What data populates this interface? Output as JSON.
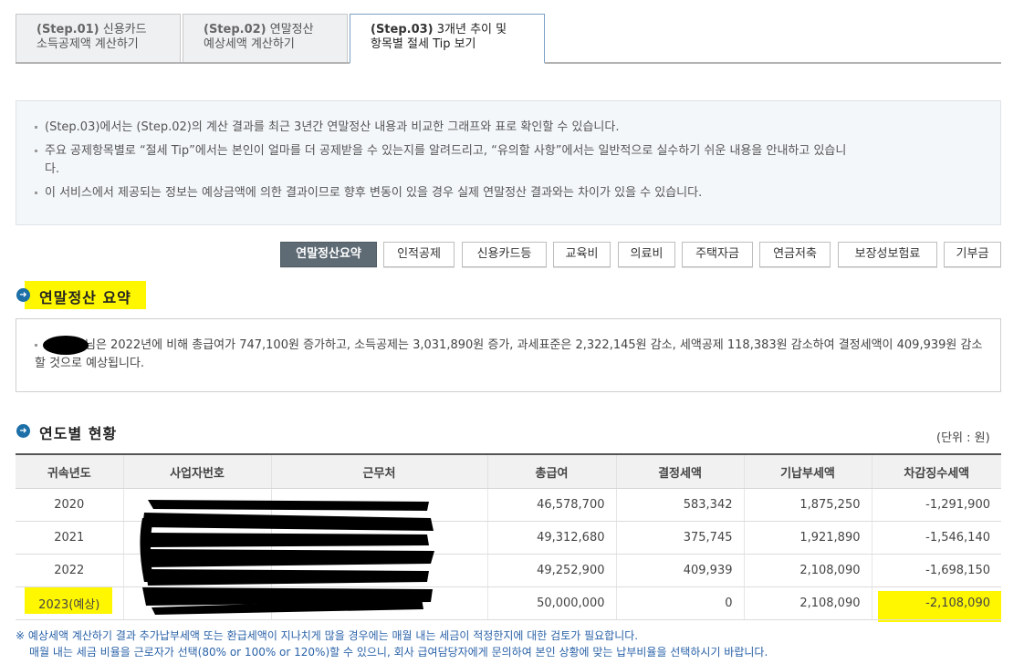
{
  "tabs": [
    {
      "step": "(Step.01)",
      "text1": "신용카드",
      "text2": "소득공제액 계산하기"
    },
    {
      "step": "(Step.02)",
      "text1": "연말정산",
      "text2": "예상세액 계산하기"
    },
    {
      "step": "(Step.03)",
      "text1": "3개년 추이 및",
      "text2": "항목별 절세 Tip 보기"
    }
  ],
  "info": {
    "line1": "(Step.03)에서는 (Step.02)의 계산 결과를 최근 3년간 연말정산 내용과 비교한 그래프와 표로 확인할 수 있습니다.",
    "line2a": "주요 공제항목별로 “절세 Tip”에서는 본인이 얼마를 더 공제받을 수 있는지를 알려드리고, “유의할 사항”에서는 일반적으로 실수하기 쉬운 내용을 안내하고 있습니",
    "line2b": "다.",
    "line3": "이 서비스에서 제공되는 정보는 예상금액에 의한 결과이므로 향후 변동이 있을 경우 실제 연말정산 결과와는 차이가 있을 수 있습니다."
  },
  "categories": [
    "연말정산요약",
    "인적공제",
    "신용카드등",
    "교육비",
    "의료비",
    "주택자금",
    "연금저축",
    "보장성보험료",
    "기부금"
  ],
  "summary": {
    "title": "연말정산 요약",
    "text": "님은 2022년에 비해 총급여가 747,100원 증가하고, 소득공제는 3,031,890원 증가, 과세표준은 2,322,145원 감소, 세액공제 118,383원 감소하여 결정세액이 409,939원 감소할 것으로 예상됩니다."
  },
  "yearly": {
    "title": "연도별 현황",
    "unit": "(단위 : 원)",
    "headers": [
      "귀속년도",
      "사업자번호",
      "근무처",
      "총급여",
      "결정세액",
      "기납부세액",
      "차감징수세액"
    ],
    "rows": [
      [
        "2020",
        "",
        "",
        "46,578,700",
        "583,342",
        "1,875,250",
        "-1,291,900"
      ],
      [
        "2021",
        "",
        "",
        "49,312,680",
        "375,745",
        "1,921,890",
        "-1,546,140"
      ],
      [
        "2022",
        "",
        "",
        "49,252,900",
        "409,939",
        "2,108,090",
        "-1,698,150"
      ],
      [
        "2023(예상)",
        "",
        "",
        "50,000,000",
        "0",
        "2,108,090",
        "-2,108,090"
      ]
    ]
  },
  "notes": {
    "line1": "※ 예상세액 계산하기 결과 추가납부세액 또는 환급세액이 지나치게 많을 경우에는 매월 내는 세금이 적정한지에 대한 검토가 필요합니다.",
    "line2": "매월 내는 세금 비율을 근로자가 선택(80% or 100% or 120%)할 수 있으니, 회사 급여담당자에게 문의하여 본인 상황에 맞는 납부비율을 선택하시기 바랍니다."
  }
}
